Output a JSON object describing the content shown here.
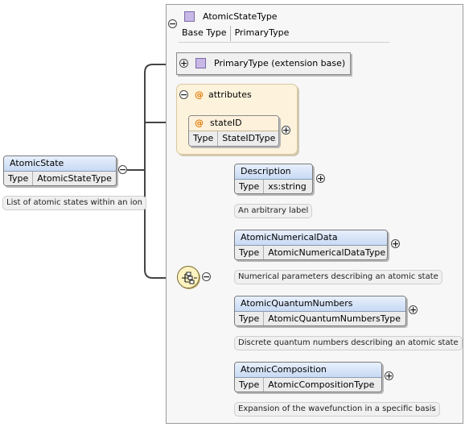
{
  "root": {
    "name": "AtomicState",
    "type_key": "Type",
    "type_value": "AtomicStateType",
    "doc": "List of atomic states within an ion",
    "collapse_symbol": "−"
  },
  "complex_type": {
    "name": "AtomicStateType",
    "base_type_label": "Base Type",
    "base_type_value": "PrimaryType",
    "collapse_symbol": "−"
  },
  "extension": {
    "label": "PrimaryType (extension base)",
    "expand_symbol": "+"
  },
  "attributes": {
    "title": "attributes",
    "at_symbol": "@",
    "collapse_symbol": "−",
    "items": [
      {
        "name": "stateID",
        "type_key": "Type",
        "type_value": "StateIDType",
        "expand_symbol": "+"
      }
    ]
  },
  "sequence": {
    "collapse_symbol": "−",
    "elements": [
      {
        "name": "Description",
        "type_key": "Type",
        "type_value": "xs:string",
        "doc": "An arbitrary label",
        "expand_symbol": "+"
      },
      {
        "name": "AtomicNumericalData",
        "type_key": "Type",
        "type_value": "AtomicNumericalDataType",
        "doc": "Numerical parameters describing an atomic state",
        "expand_symbol": "+"
      },
      {
        "name": "AtomicQuantumNumbers",
        "type_key": "Type",
        "type_value": "AtomicQuantumNumbersType",
        "doc": "Discrete quantum numbers describing an atomic state",
        "expand_symbol": "+"
      },
      {
        "name": "AtomicComposition",
        "type_key": "Type",
        "type_value": "AtomicCompositionType",
        "doc": "Expansion of the wavefunction in a specific basis",
        "expand_symbol": "+"
      }
    ]
  },
  "colors": {
    "element_header": "#c8daf4",
    "attribute_header": "#fdf3dc",
    "attribute_symbol": "#e07800",
    "complex_type_icon": "#c7b8e6",
    "connector": "#444444"
  }
}
